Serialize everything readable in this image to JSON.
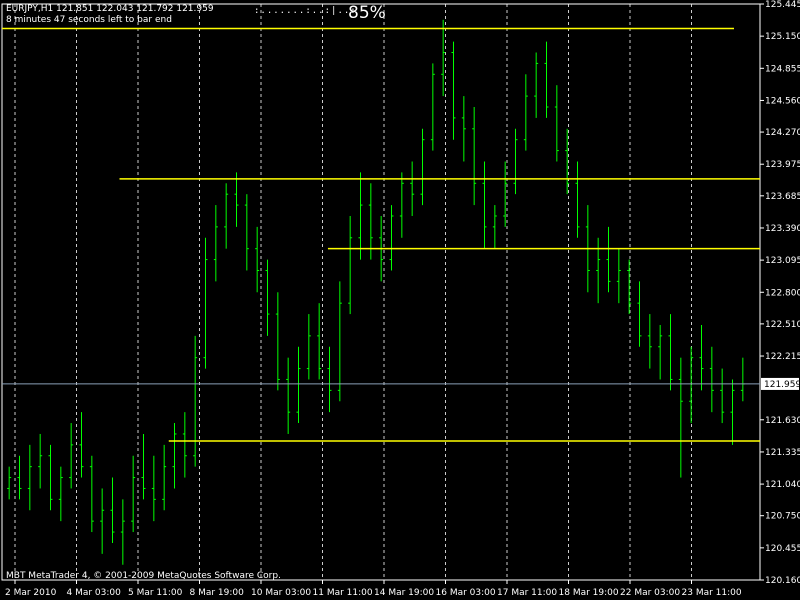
{
  "header": {
    "symbol_line": "EURJPY,H1  121.851 122.043 121.792 121.959",
    "timer": "8 minutes 47 seconds left to bar end",
    "progress": "85%",
    "progress_ticks": ":.......:..:|..:"
  },
  "footer": {
    "copyright": "MBT MetaTrader 4, © 2001-2009 MetaQuotes Software Corp."
  },
  "colors": {
    "background": "#000000",
    "candles": "#00ff00",
    "levels": "#ffff00",
    "grid": "#ffffff",
    "text": "#ffffff"
  },
  "chart_data": {
    "type": "bar",
    "symbol": "EURJPY",
    "timeframe": "H1",
    "ohlc_current": {
      "open": 121.851,
      "high": 122.043,
      "low": 121.792,
      "close": 121.959
    },
    "current_price": "121.959",
    "ylim": [
      120.16,
      125.445
    ],
    "y_ticks": [
      "125.445",
      "125.150",
      "124.855",
      "124.560",
      "124.270",
      "123.975",
      "123.685",
      "123.390",
      "123.095",
      "122.800",
      "122.510",
      "122.215",
      "121.630",
      "121.335",
      "121.040",
      "120.750",
      "120.455",
      "120.160"
    ],
    "x_ticks": [
      "2 Mar 2010",
      "4 Mar 03:00",
      "5 Mar 11:00",
      "8 Mar 19:00",
      "10 Mar 03:00",
      "11 Mar 11:00",
      "14 Mar 19:00",
      "16 Mar 03:00",
      "17 Mar 11:00",
      "18 Mar 19:00",
      "22 Mar 03:00",
      "23 Mar 11:00"
    ],
    "grid": true,
    "bar_series": [
      [
        121.0,
        121.2,
        120.9,
        121.1
      ],
      [
        121.1,
        121.3,
        120.9,
        121.0
      ],
      [
        121.0,
        121.4,
        120.8,
        121.2
      ],
      [
        121.2,
        121.5,
        121.0,
        121.3
      ],
      [
        121.3,
        121.4,
        120.8,
        120.9
      ],
      [
        120.9,
        121.2,
        120.7,
        121.1
      ],
      [
        121.1,
        121.6,
        121.0,
        121.4
      ],
      [
        121.4,
        121.7,
        121.1,
        121.2
      ],
      [
        121.2,
        121.3,
        120.6,
        120.7
      ],
      [
        120.7,
        121.0,
        120.4,
        120.8
      ],
      [
        120.8,
        121.1,
        120.5,
        120.6
      ],
      [
        120.6,
        120.9,
        120.3,
        120.7
      ],
      [
        120.7,
        121.3,
        120.6,
        121.1
      ],
      [
        121.1,
        121.5,
        120.9,
        121.0
      ],
      [
        121.0,
        121.3,
        120.7,
        120.9
      ],
      [
        120.9,
        121.4,
        120.8,
        121.2
      ],
      [
        121.2,
        121.6,
        121.0,
        121.5
      ],
      [
        121.5,
        121.7,
        121.1,
        121.3
      ],
      [
        121.3,
        122.4,
        121.2,
        122.2
      ],
      [
        122.2,
        123.3,
        122.1,
        123.1
      ],
      [
        123.1,
        123.6,
        122.9,
        123.4
      ],
      [
        123.4,
        123.8,
        123.2,
        123.7
      ],
      [
        123.7,
        123.9,
        123.4,
        123.6
      ],
      [
        123.6,
        123.7,
        123.0,
        123.2
      ],
      [
        123.2,
        123.4,
        122.8,
        123.0
      ],
      [
        123.0,
        123.1,
        122.4,
        122.6
      ],
      [
        122.6,
        122.8,
        121.9,
        122.0
      ],
      [
        122.0,
        122.2,
        121.5,
        121.7
      ],
      [
        121.7,
        122.3,
        121.6,
        122.1
      ],
      [
        122.1,
        122.6,
        122.0,
        122.4
      ],
      [
        122.4,
        122.7,
        122.0,
        122.1
      ],
      [
        122.1,
        122.3,
        121.7,
        121.9
      ],
      [
        121.9,
        122.9,
        121.8,
        122.7
      ],
      [
        122.7,
        123.5,
        122.6,
        123.3
      ],
      [
        123.3,
        123.9,
        123.1,
        123.6
      ],
      [
        123.6,
        123.8,
        123.1,
        123.3
      ],
      [
        123.3,
        123.5,
        122.9,
        123.1
      ],
      [
        123.1,
        123.6,
        123.0,
        123.5
      ],
      [
        123.5,
        123.9,
        123.3,
        123.8
      ],
      [
        123.8,
        124.0,
        123.5,
        123.7
      ],
      [
        123.7,
        124.3,
        123.6,
        124.2
      ],
      [
        124.2,
        124.9,
        124.1,
        124.8
      ],
      [
        124.8,
        125.3,
        124.6,
        125.0
      ],
      [
        125.0,
        125.1,
        124.2,
        124.4
      ],
      [
        124.4,
        124.6,
        124.0,
        124.3
      ],
      [
        124.3,
        124.5,
        123.6,
        123.8
      ],
      [
        123.8,
        124.0,
        123.2,
        123.4
      ],
      [
        123.4,
        123.6,
        123.2,
        123.5
      ],
      [
        123.5,
        124.0,
        123.4,
        123.8
      ],
      [
        123.8,
        124.3,
        123.7,
        124.2
      ],
      [
        124.2,
        124.8,
        124.1,
        124.6
      ],
      [
        124.6,
        125.0,
        124.4,
        124.9
      ],
      [
        124.9,
        125.1,
        124.4,
        124.5
      ],
      [
        124.5,
        124.7,
        124.0,
        124.1
      ],
      [
        124.1,
        124.3,
        123.7,
        123.8
      ],
      [
        123.8,
        124.0,
        123.3,
        123.4
      ],
      [
        123.4,
        123.6,
        122.8,
        123.0
      ],
      [
        123.0,
        123.3,
        122.7,
        123.1
      ],
      [
        123.1,
        123.4,
        122.8,
        122.9
      ],
      [
        122.9,
        123.2,
        122.7,
        123.0
      ],
      [
        123.0,
        123.1,
        122.6,
        122.7
      ],
      [
        122.7,
        122.9,
        122.3,
        122.4
      ],
      [
        122.4,
        122.6,
        122.1,
        122.3
      ],
      [
        122.3,
        122.5,
        122.0,
        122.4
      ],
      [
        122.4,
        122.6,
        121.9,
        122.0
      ],
      [
        122.0,
        122.2,
        121.1,
        121.8
      ],
      [
        121.8,
        122.3,
        121.6,
        122.2
      ],
      [
        122.2,
        122.5,
        121.9,
        122.1
      ],
      [
        122.1,
        122.3,
        121.7,
        121.9
      ],
      [
        121.9,
        122.1,
        121.6,
        121.7
      ],
      [
        121.7,
        122.0,
        121.4,
        121.9
      ],
      [
        121.9,
        122.2,
        121.8,
        121.959
      ]
    ]
  },
  "levels": [
    {
      "price": 125.22,
      "from": 0.0
    },
    {
      "price": 123.84,
      "from": 0.155
    },
    {
      "price": 123.2,
      "from": 0.43
    },
    {
      "price": 121.435,
      "from": 0.22
    }
  ]
}
